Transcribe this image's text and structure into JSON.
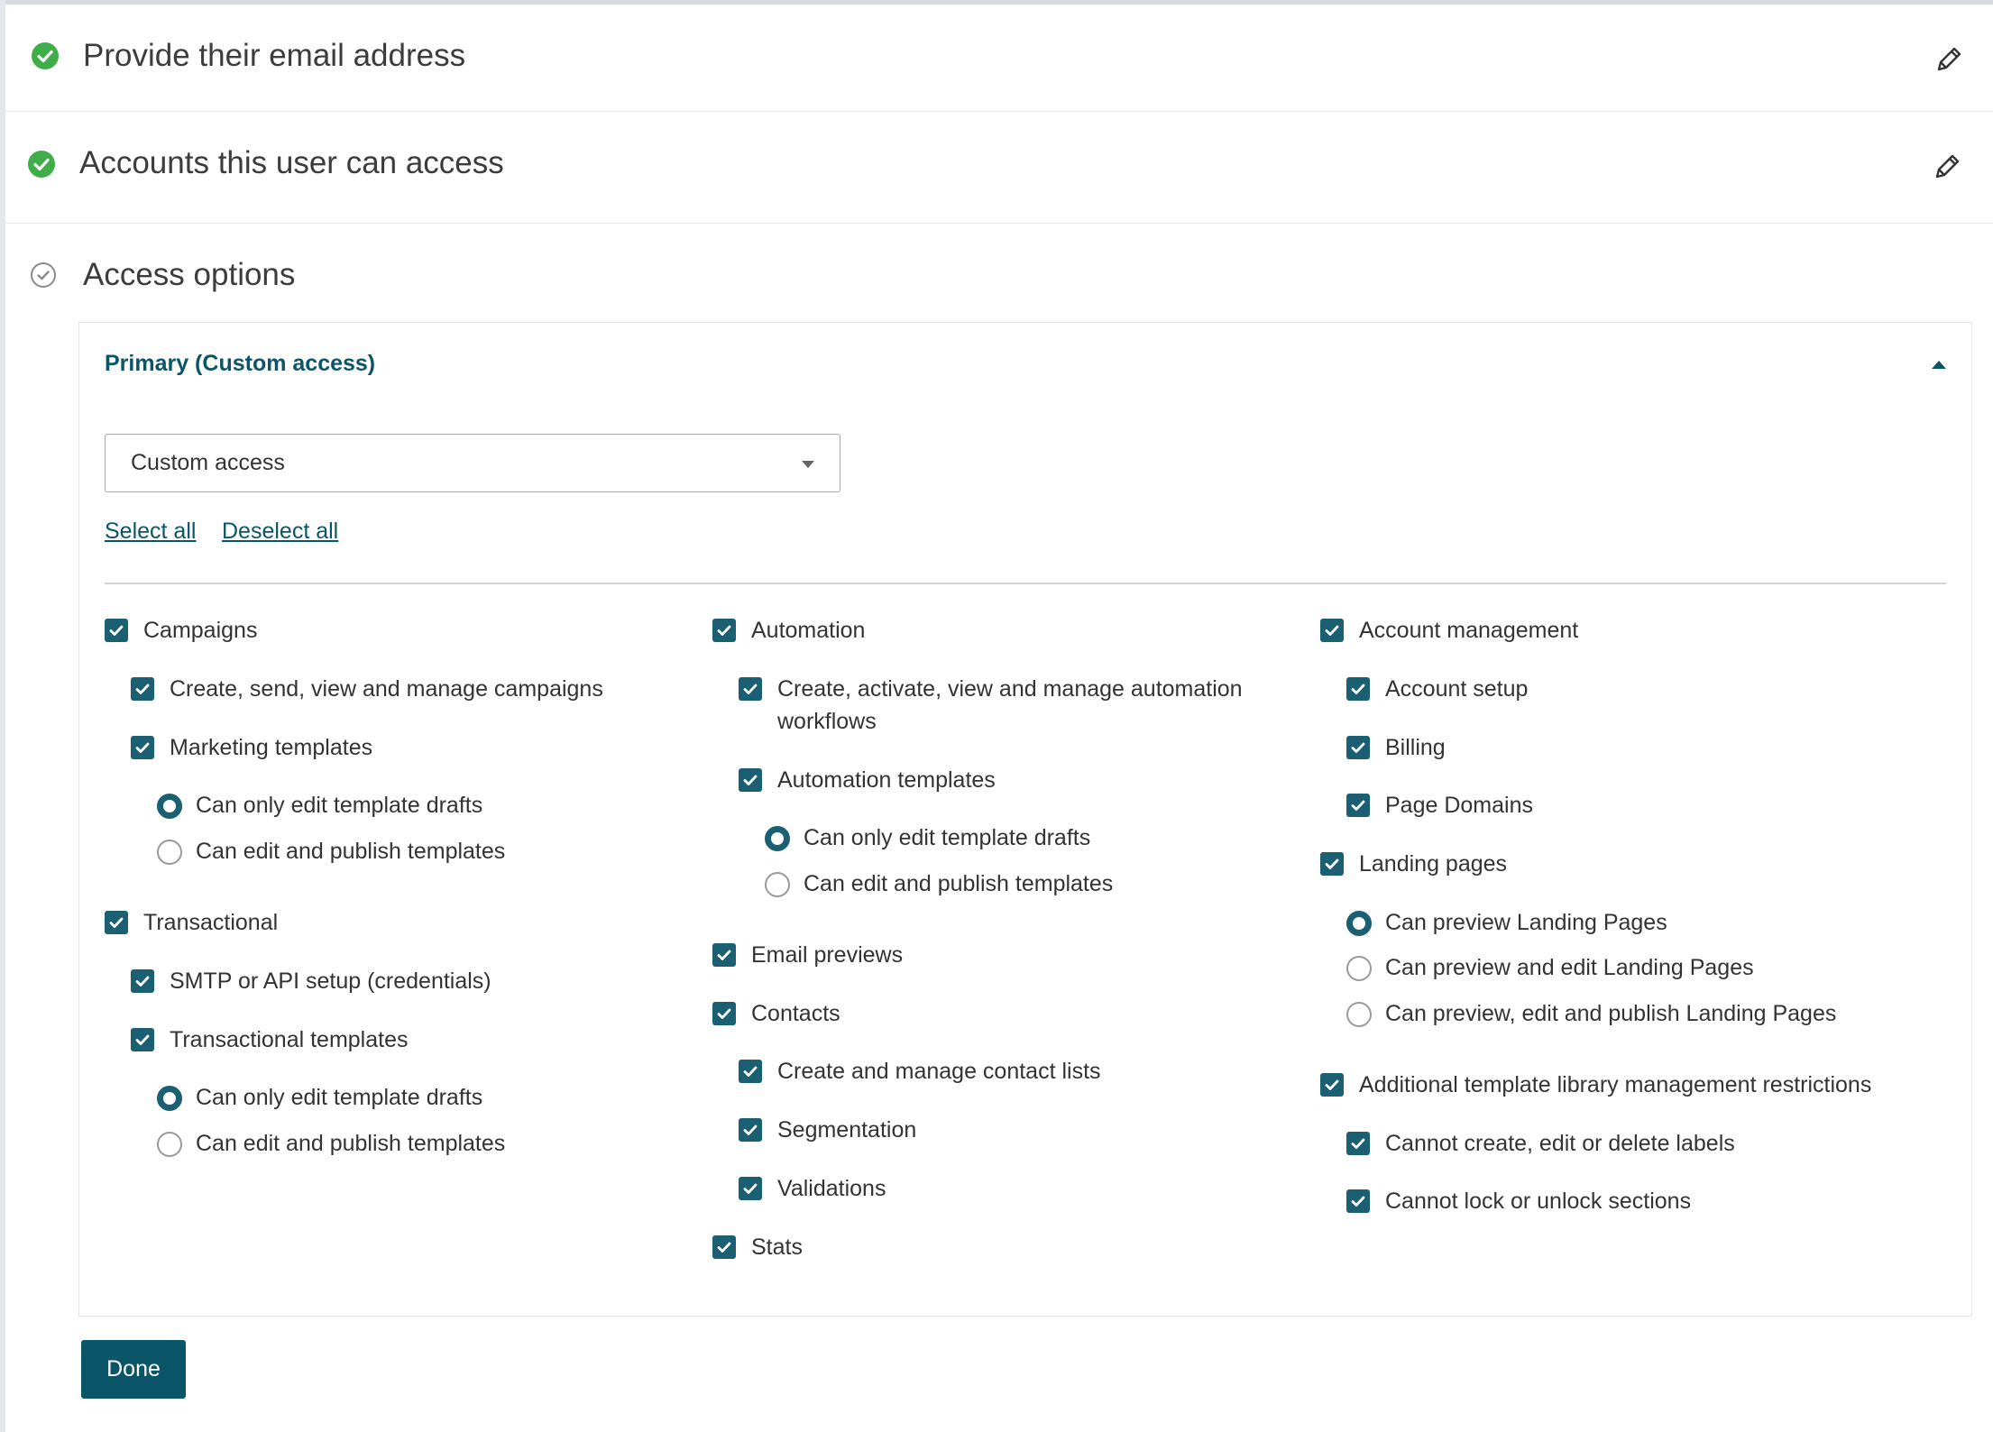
{
  "steps": {
    "email": {
      "title": "Provide their email address"
    },
    "accounts": {
      "title": "Accounts this user can access"
    },
    "access": {
      "title": "Access options"
    }
  },
  "panel": {
    "title": "Primary (Custom access)",
    "select_value": "Custom access",
    "select_all": "Select all",
    "deselect_all": "Deselect all"
  },
  "col1": {
    "campaigns": "Campaigns",
    "create_campaigns": "Create, send, view and manage campaigns",
    "marketing_templates": "Marketing templates",
    "mkt_drafts": "Can only edit template drafts",
    "mkt_publish": "Can edit and publish templates",
    "transactional": "Transactional",
    "smtp": "SMTP or API setup (credentials)",
    "trans_templates": "Transactional templates",
    "trans_drafts": "Can only edit template drafts",
    "trans_publish": "Can edit and publish templates"
  },
  "col2": {
    "automation": "Automation",
    "create_automation": "Create, activate, view and manage automation workflows",
    "automation_templates": "Automation templates",
    "auto_drafts": "Can only edit template drafts",
    "auto_publish": "Can edit and publish templates",
    "email_previews": "Email previews",
    "contacts": "Contacts",
    "contact_lists": "Create and manage contact lists",
    "segmentation": "Segmentation",
    "validations": "Validations",
    "stats": "Stats"
  },
  "col3": {
    "account_management": "Account management",
    "account_setup": "Account setup",
    "billing": "Billing",
    "page_domains": "Page Domains",
    "landing_pages": "Landing pages",
    "lp_preview": "Can preview Landing Pages",
    "lp_edit": "Can preview and edit Landing Pages",
    "lp_publish": "Can preview, edit and publish Landing Pages",
    "additional": "Additional template library management restrictions",
    "no_labels": "Cannot create, edit or delete labels",
    "no_lock": "Cannot lock or unlock sections"
  },
  "done_label": "Done",
  "colors": {
    "accent": "#0b5568",
    "checkbox": "#1b5f72",
    "success": "#3fae49"
  }
}
